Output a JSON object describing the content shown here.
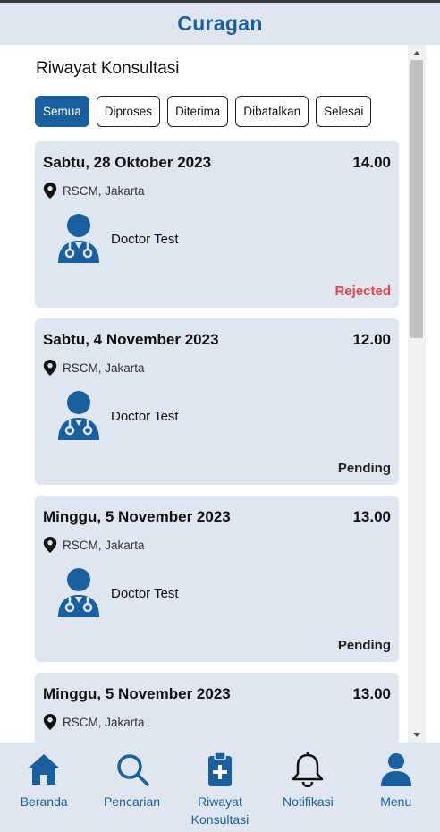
{
  "app": {
    "title": "Curagan"
  },
  "page": {
    "title": "Riwayat Konsultasi"
  },
  "filters": [
    {
      "label": "Semua",
      "active": true
    },
    {
      "label": "Diproses",
      "active": false
    },
    {
      "label": "Diterima",
      "active": false
    },
    {
      "label": "Dibatalkan",
      "active": false
    },
    {
      "label": "Selesai",
      "active": false
    }
  ],
  "appointments": [
    {
      "date": "Sabtu, 28 Oktober 2023",
      "time": "14.00",
      "location": "RSCM, Jakarta",
      "doctor": "Doctor Test",
      "status": "Rejected"
    },
    {
      "date": "Sabtu, 4 November 2023",
      "time": "12.00",
      "location": "RSCM, Jakarta",
      "doctor": "Doctor Test",
      "status": "Pending"
    },
    {
      "date": "Minggu, 5 November 2023",
      "time": "13.00",
      "location": "RSCM, Jakarta",
      "doctor": "Doctor Test",
      "status": "Pending"
    },
    {
      "date": "Minggu, 5 November 2023",
      "time": "13.00",
      "location": "RSCM, Jakarta",
      "doctor": "",
      "status": ""
    }
  ],
  "bottom_nav": [
    {
      "label": "Beranda",
      "icon": "home-icon"
    },
    {
      "label": "Pencarian",
      "icon": "search-icon"
    },
    {
      "label": "Riwayat Konsultasi",
      "icon": "clipboard-medical-icon"
    },
    {
      "label": "Notifikasi",
      "icon": "bell-icon"
    },
    {
      "label": "Menu",
      "icon": "user-icon"
    }
  ],
  "colors": {
    "primary": "#1a5f9e",
    "card_bg": "#dfe6f0",
    "rejected": "#e0454f"
  }
}
